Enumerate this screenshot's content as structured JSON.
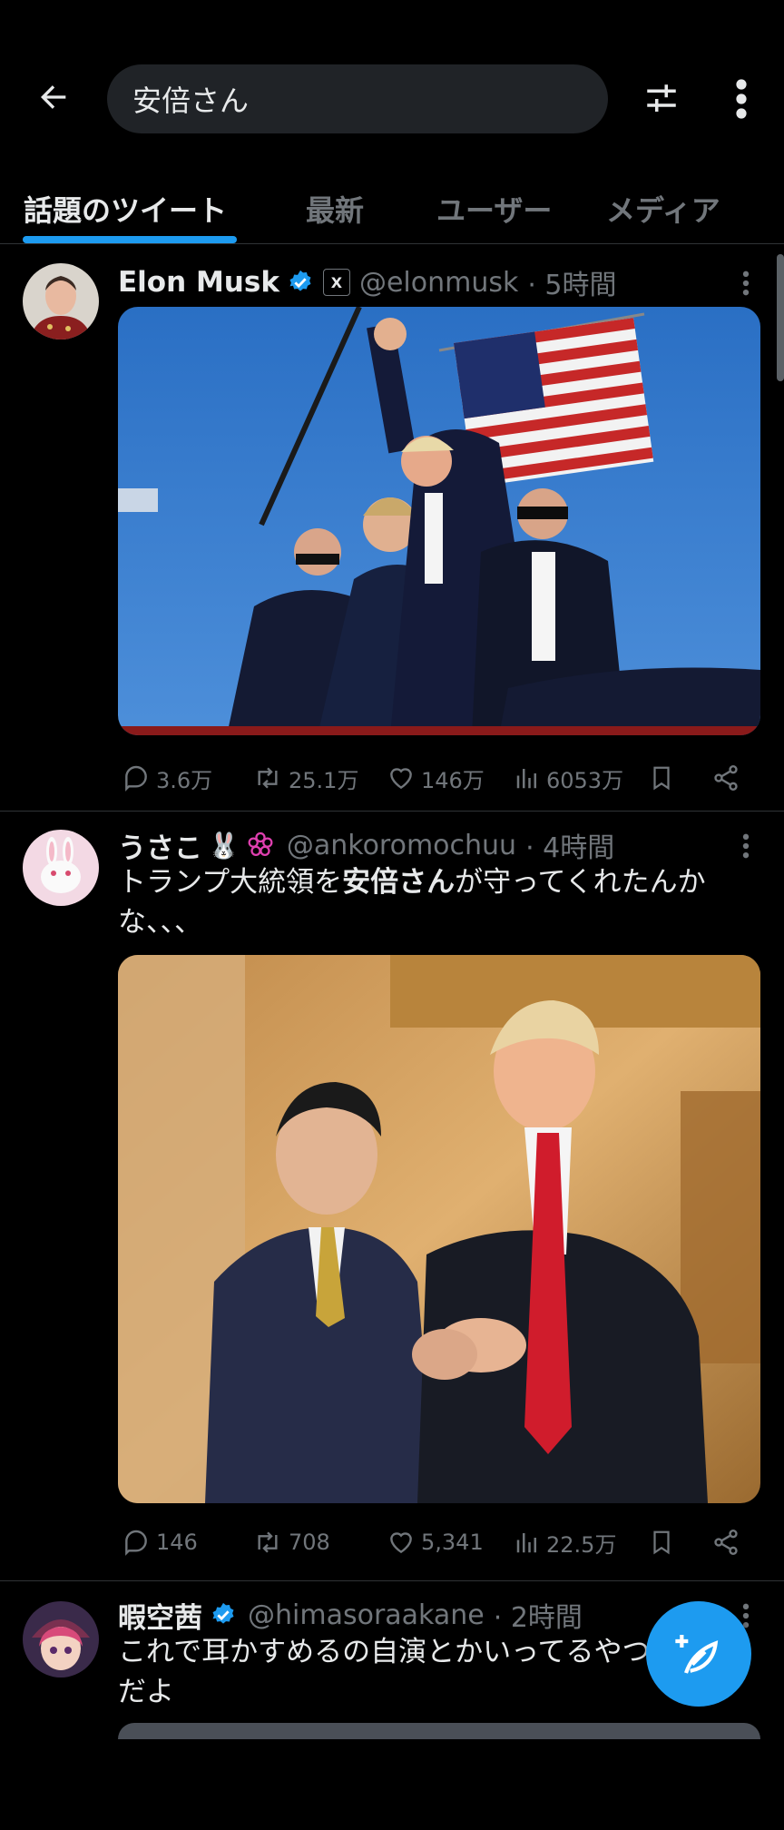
{
  "header": {
    "search_value": "安倍さん",
    "back_icon": "arrow-left-icon",
    "filter_icon": "sliders-icon",
    "more_icon": "more-vertical-icon"
  },
  "tabs": [
    {
      "label": "話題のツイート",
      "active": true
    },
    {
      "label": "最新",
      "active": false
    },
    {
      "label": "ユーザー",
      "active": false
    },
    {
      "label": "メディア",
      "active": false
    }
  ],
  "tweets": [
    {
      "name": "Elon Musk",
      "verified": true,
      "affiliate_badge": "X",
      "handle": "@elonmusk",
      "time": "· 5時間",
      "text": "",
      "stats": {
        "replies": "3.6万",
        "retweets": "25.1万",
        "likes": "146万",
        "views": "6053万"
      }
    },
    {
      "name": "うさこ",
      "name_emoji": "🐰",
      "handle": "@ankoromochuu",
      "time": "· 4時間",
      "text_before": "トランプ大統領を",
      "text_bold": "安倍さん",
      "text_after": "が守ってくれたんかな、、、",
      "stats": {
        "replies": "146",
        "retweets": "708",
        "likes": "5,341",
        "views": "22.5万"
      }
    },
    {
      "name": "暇空茜",
      "verified": true,
      "handle": "@himasoraakane",
      "time": "· 2時間",
      "text": "これで耳かすめるの自演とかいってるやつらバカだよ"
    }
  ],
  "colors": {
    "accent": "#1d9bf0",
    "background": "#000000",
    "muted": "#71767b",
    "text": "#e7e9ea"
  }
}
